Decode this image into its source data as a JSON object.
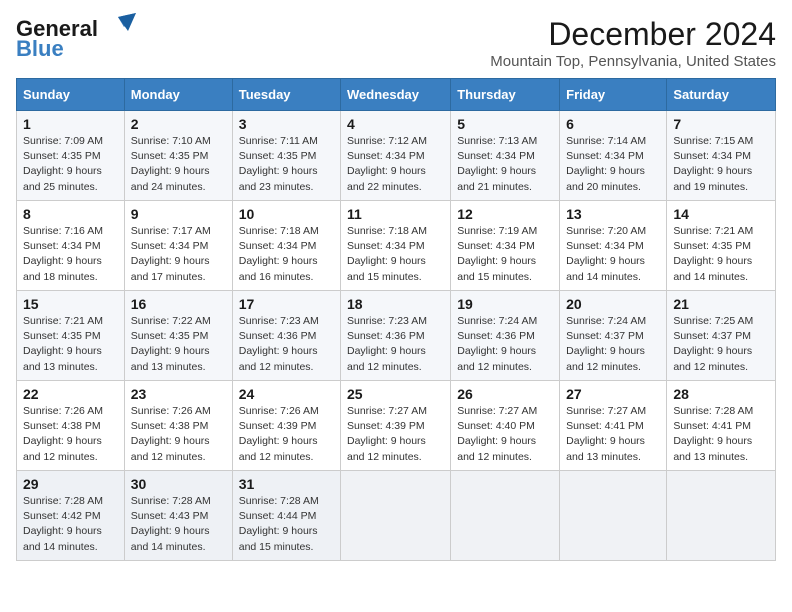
{
  "header": {
    "logo_line1": "General",
    "logo_line2": "Blue",
    "title": "December 2024",
    "subtitle": "Mountain Top, Pennsylvania, United States"
  },
  "calendar": {
    "columns": [
      "Sunday",
      "Monday",
      "Tuesday",
      "Wednesday",
      "Thursday",
      "Friday",
      "Saturday"
    ],
    "weeks": [
      [
        {
          "day": "1",
          "info": "Sunrise: 7:09 AM\nSunset: 4:35 PM\nDaylight: 9 hours\nand 25 minutes."
        },
        {
          "day": "2",
          "info": "Sunrise: 7:10 AM\nSunset: 4:35 PM\nDaylight: 9 hours\nand 24 minutes."
        },
        {
          "day": "3",
          "info": "Sunrise: 7:11 AM\nSunset: 4:35 PM\nDaylight: 9 hours\nand 23 minutes."
        },
        {
          "day": "4",
          "info": "Sunrise: 7:12 AM\nSunset: 4:34 PM\nDaylight: 9 hours\nand 22 minutes."
        },
        {
          "day": "5",
          "info": "Sunrise: 7:13 AM\nSunset: 4:34 PM\nDaylight: 9 hours\nand 21 minutes."
        },
        {
          "day": "6",
          "info": "Sunrise: 7:14 AM\nSunset: 4:34 PM\nDaylight: 9 hours\nand 20 minutes."
        },
        {
          "day": "7",
          "info": "Sunrise: 7:15 AM\nSunset: 4:34 PM\nDaylight: 9 hours\nand 19 minutes."
        }
      ],
      [
        {
          "day": "8",
          "info": "Sunrise: 7:16 AM\nSunset: 4:34 PM\nDaylight: 9 hours\nand 18 minutes."
        },
        {
          "day": "9",
          "info": "Sunrise: 7:17 AM\nSunset: 4:34 PM\nDaylight: 9 hours\nand 17 minutes."
        },
        {
          "day": "10",
          "info": "Sunrise: 7:18 AM\nSunset: 4:34 PM\nDaylight: 9 hours\nand 16 minutes."
        },
        {
          "day": "11",
          "info": "Sunrise: 7:18 AM\nSunset: 4:34 PM\nDaylight: 9 hours\nand 15 minutes."
        },
        {
          "day": "12",
          "info": "Sunrise: 7:19 AM\nSunset: 4:34 PM\nDaylight: 9 hours\nand 15 minutes."
        },
        {
          "day": "13",
          "info": "Sunrise: 7:20 AM\nSunset: 4:34 PM\nDaylight: 9 hours\nand 14 minutes."
        },
        {
          "day": "14",
          "info": "Sunrise: 7:21 AM\nSunset: 4:35 PM\nDaylight: 9 hours\nand 14 minutes."
        }
      ],
      [
        {
          "day": "15",
          "info": "Sunrise: 7:21 AM\nSunset: 4:35 PM\nDaylight: 9 hours\nand 13 minutes."
        },
        {
          "day": "16",
          "info": "Sunrise: 7:22 AM\nSunset: 4:35 PM\nDaylight: 9 hours\nand 13 minutes."
        },
        {
          "day": "17",
          "info": "Sunrise: 7:23 AM\nSunset: 4:36 PM\nDaylight: 9 hours\nand 12 minutes."
        },
        {
          "day": "18",
          "info": "Sunrise: 7:23 AM\nSunset: 4:36 PM\nDaylight: 9 hours\nand 12 minutes."
        },
        {
          "day": "19",
          "info": "Sunrise: 7:24 AM\nSunset: 4:36 PM\nDaylight: 9 hours\nand 12 minutes."
        },
        {
          "day": "20",
          "info": "Sunrise: 7:24 AM\nSunset: 4:37 PM\nDaylight: 9 hours\nand 12 minutes."
        },
        {
          "day": "21",
          "info": "Sunrise: 7:25 AM\nSunset: 4:37 PM\nDaylight: 9 hours\nand 12 minutes."
        }
      ],
      [
        {
          "day": "22",
          "info": "Sunrise: 7:26 AM\nSunset: 4:38 PM\nDaylight: 9 hours\nand 12 minutes."
        },
        {
          "day": "23",
          "info": "Sunrise: 7:26 AM\nSunset: 4:38 PM\nDaylight: 9 hours\nand 12 minutes."
        },
        {
          "day": "24",
          "info": "Sunrise: 7:26 AM\nSunset: 4:39 PM\nDaylight: 9 hours\nand 12 minutes."
        },
        {
          "day": "25",
          "info": "Sunrise: 7:27 AM\nSunset: 4:39 PM\nDaylight: 9 hours\nand 12 minutes."
        },
        {
          "day": "26",
          "info": "Sunrise: 7:27 AM\nSunset: 4:40 PM\nDaylight: 9 hours\nand 12 minutes."
        },
        {
          "day": "27",
          "info": "Sunrise: 7:27 AM\nSunset: 4:41 PM\nDaylight: 9 hours\nand 13 minutes."
        },
        {
          "day": "28",
          "info": "Sunrise: 7:28 AM\nSunset: 4:41 PM\nDaylight: 9 hours\nand 13 minutes."
        }
      ],
      [
        {
          "day": "29",
          "info": "Sunrise: 7:28 AM\nSunset: 4:42 PM\nDaylight: 9 hours\nand 14 minutes."
        },
        {
          "day": "30",
          "info": "Sunrise: 7:28 AM\nSunset: 4:43 PM\nDaylight: 9 hours\nand 14 minutes."
        },
        {
          "day": "31",
          "info": "Sunrise: 7:28 AM\nSunset: 4:44 PM\nDaylight: 9 hours\nand 15 minutes."
        },
        null,
        null,
        null,
        null
      ]
    ]
  }
}
